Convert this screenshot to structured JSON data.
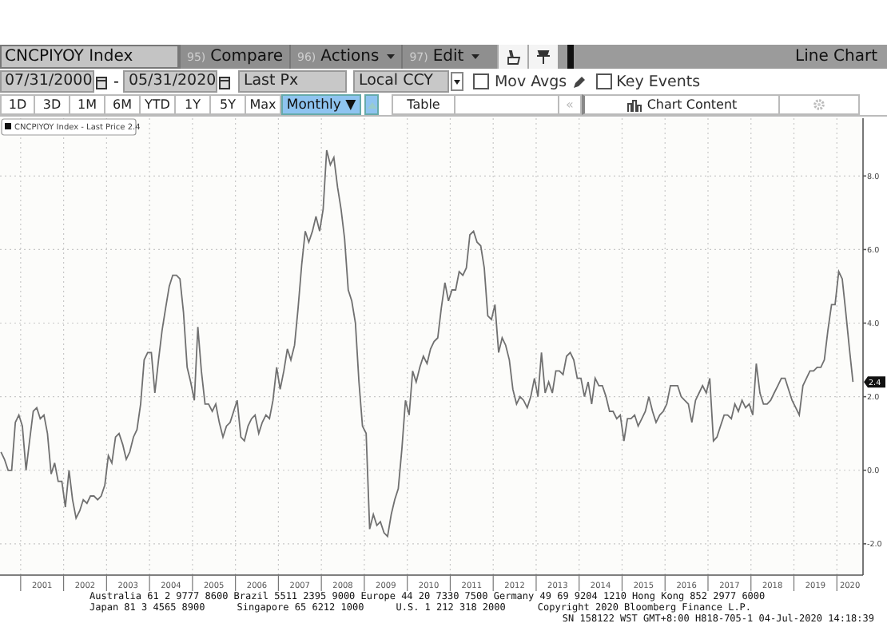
{
  "security_field": {
    "value": "CNCPIYOY Index"
  },
  "menu_buttons": [
    {
      "number": "95)",
      "label": "Compare",
      "dropdown": false
    },
    {
      "number": "96)",
      "label": "Actions",
      "dropdown": true
    },
    {
      "number": "97)",
      "label": "Edit",
      "dropdown": true
    }
  ],
  "chart_type": "Line Chart",
  "start_date": "07/31/2000",
  "date_separator": "-",
  "end_date": "05/31/2020",
  "price_field": "Last Px",
  "currency_field": "Local CCY",
  "options": [
    {
      "label": "Mov Avgs",
      "checked": false,
      "editable": true
    },
    {
      "label": "Key Events",
      "checked": false,
      "editable": false
    }
  ],
  "ranges": [
    {
      "label": "1D",
      "selected": false
    },
    {
      "label": "3D",
      "selected": false
    },
    {
      "label": "1M",
      "selected": false
    },
    {
      "label": "6M",
      "selected": false
    },
    {
      "label": "YTD",
      "selected": false
    },
    {
      "label": "1Y",
      "selected": false
    },
    {
      "label": "5Y",
      "selected": false
    },
    {
      "label": "Max",
      "selected": false
    }
  ],
  "frequency": {
    "label": "Monthly ▼"
  },
  "table_button": "Table",
  "scroll_left": "«",
  "chart_content": "Chart Content",
  "chart": {
    "legend_suffix": "- Last Price 2.4",
    "last_price_tag": "2.4",
    "year_labels": [
      "2001",
      "2002",
      "2003",
      "2004",
      "2005",
      "2006",
      "2007",
      "2008",
      "2009",
      "2010",
      "2011",
      "2012",
      "2013",
      "2014",
      "2015",
      "2016",
      "2017",
      "2018",
      "2019",
      "2020"
    ],
    "chart_data": {
      "type": "line",
      "ylim": [
        -2.85,
        9.57
      ],
      "grid": true,
      "yticks": [
        {
          "value": -2,
          "label": "-2.0"
        },
        {
          "value": 0,
          "label": "0.0"
        },
        {
          "value": 2,
          "label": "2.0"
        },
        {
          "value": 4,
          "label": "4.0"
        },
        {
          "value": 6,
          "label": "6.0"
        },
        {
          "value": 8,
          "label": "8.0"
        }
      ],
      "series": [
        {
          "name": "CNCPIYOY Index",
          "color": "#707070",
          "values": [
            0.5,
            0.3,
            0,
            0,
            1.3,
            1.5,
            1.2,
            0,
            0.8,
            1.6,
            1.7,
            1.4,
            1.5,
            1.0,
            -0.1,
            0.2,
            -0.3,
            -0.3,
            -1.0,
            0,
            -0.8,
            -1.3,
            -1.1,
            -0.8,
            -0.9,
            -0.7,
            -0.7,
            -0.8,
            -0.7,
            -0.4,
            0.4,
            0.2,
            0.9,
            1.0,
            0.7,
            0.3,
            0.5,
            0.9,
            1.1,
            1.8,
            3.0,
            3.2,
            3.2,
            2.1,
            3.0,
            3.8,
            4.4,
            5.0,
            5.3,
            5.3,
            5.2,
            4.3,
            2.8,
            2.4,
            1.9,
            3.9,
            2.7,
            1.8,
            1.8,
            1.6,
            1.8,
            1.3,
            0.9,
            1.2,
            1.3,
            1.6,
            1.9,
            0.9,
            0.8,
            1.2,
            1.4,
            1.5,
            1.0,
            1.3,
            1.5,
            1.4,
            1.9,
            2.8,
            2.2,
            2.7,
            3.3,
            3.0,
            3.4,
            4.4,
            5.6,
            6.5,
            6.2,
            6.5,
            6.9,
            6.5,
            7.1,
            8.7,
            8.3,
            8.5,
            7.7,
            7.1,
            6.3,
            4.9,
            4.6,
            4.0,
            2.4,
            1.2,
            1.0,
            -1.6,
            -1.2,
            -1.5,
            -1.4,
            -1.7,
            -1.8,
            -1.2,
            -0.8,
            -0.5,
            0.6,
            1.9,
            1.5,
            2.7,
            2.4,
            2.8,
            3.1,
            2.9,
            3.3,
            3.5,
            3.6,
            4.4,
            5.1,
            4.6,
            4.9,
            4.9,
            5.4,
            5.3,
            5.5,
            6.4,
            6.5,
            6.2,
            6.1,
            5.5,
            4.2,
            4.1,
            4.5,
            3.2,
            3.6,
            3.4,
            3.0,
            2.2,
            1.8,
            2.0,
            1.9,
            1.7,
            2.0,
            2.5,
            2.0,
            3.2,
            2.1,
            2.4,
            2.1,
            2.7,
            2.7,
            2.6,
            3.1,
            3.2,
            3.0,
            2.5,
            2.5,
            2.0,
            2.4,
            1.8,
            2.5,
            2.3,
            2.3,
            2.0,
            1.6,
            1.6,
            1.4,
            1.5,
            0.8,
            1.4,
            1.4,
            1.5,
            1.2,
            1.4,
            1.6,
            2.0,
            1.6,
            1.3,
            1.5,
            1.6,
            1.8,
            2.3,
            2.3,
            2.3,
            2.0,
            1.9,
            1.8,
            1.3,
            1.9,
            2.1,
            2.3,
            2.1,
            2.5,
            0.8,
            0.9,
            1.2,
            1.5,
            1.5,
            1.4,
            1.8,
            1.6,
            1.9,
            1.7,
            1.8,
            1.5,
            2.9,
            2.1,
            1.8,
            1.8,
            1.9,
            2.1,
            2.3,
            2.5,
            2.5,
            2.2,
            1.9,
            1.7,
            1.5,
            2.3,
            2.5,
            2.7,
            2.7,
            2.8,
            2.8,
            3.0,
            3.8,
            4.5,
            4.5,
            5.4,
            5.2,
            4.3,
            3.3,
            2.4
          ]
        }
      ]
    }
  },
  "footer": {
    "line_1": "Australia 61 2 9777 8600 Brazil 5511 2395 9000 Europe 44 20 7330 7500 Germany 49 69 9204 1210 Hong Kong 852 2977 6000",
    "line_2": [
      "Japan 81 3 4565 8900",
      "Singapore 65 6212 1000",
      "U.S. 1 212 318 2000",
      "Copyright 2020 Bloomberg Finance L.P."
    ],
    "line_3": "SN 158122 WST GMT+8:00 H818-705-1 04-Jul-2020 14:18:39"
  }
}
